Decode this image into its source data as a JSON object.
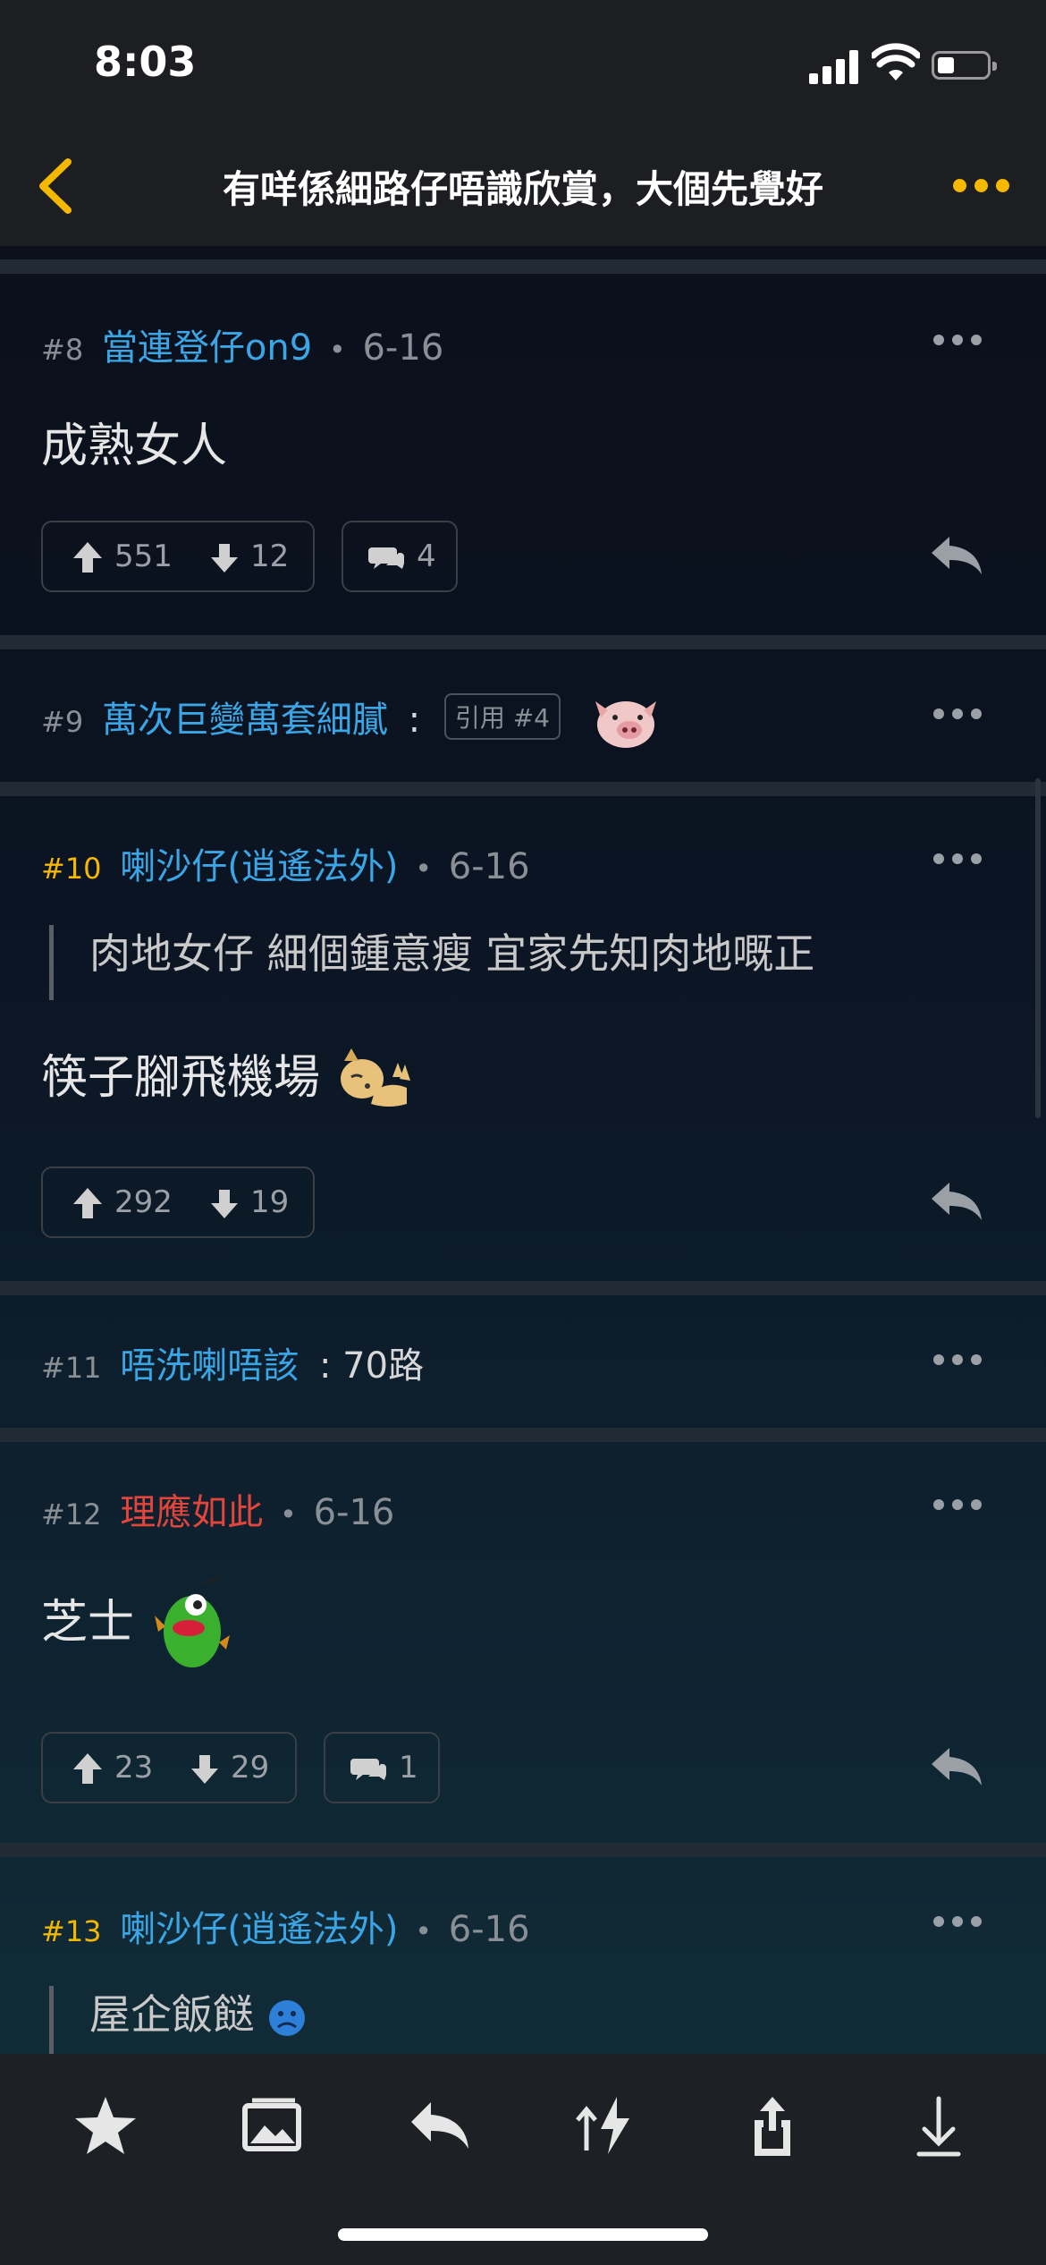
{
  "status": {
    "time": "8:03"
  },
  "nav": {
    "title": "有咩係細路仔唔識欣賞，大個先覺好"
  },
  "posts": [
    {
      "num": "#8",
      "author": "當連登仔on9",
      "date": "6-16",
      "body": "成熟女人",
      "up": "551",
      "down": "12",
      "comments": "4"
    },
    {
      "num": "#9",
      "author": "萬次巨變萬套細膩",
      "quote": "引用 #4"
    },
    {
      "num": "#10",
      "author": "喇沙仔(逍遙法外)",
      "date": "6-16",
      "quote_text": "肉地女仔 細個鍾意瘦 宜家先知肉地嘅正",
      "body": "筷子腳飛機場",
      "up": "292",
      "down": "19"
    },
    {
      "num": "#11",
      "author": "唔洗喇唔該",
      "inline": "70路"
    },
    {
      "num": "#12",
      "author": "理應如此",
      "date": "6-16",
      "body": "芝士",
      "up": "23",
      "down": "29",
      "comments": "1"
    },
    {
      "num": "#13",
      "author": "喇沙仔(逍遙法外)",
      "date": "6-16",
      "quote_text": "屋企飯餸"
    }
  ],
  "colors": {
    "accent": "#f5b800",
    "author_blue": "#3aa6e6",
    "author_red": "#e2453c"
  },
  "tabbar": [
    "star-icon",
    "image-icon",
    "reply-icon",
    "sort-icon",
    "share-icon",
    "download-icon"
  ]
}
